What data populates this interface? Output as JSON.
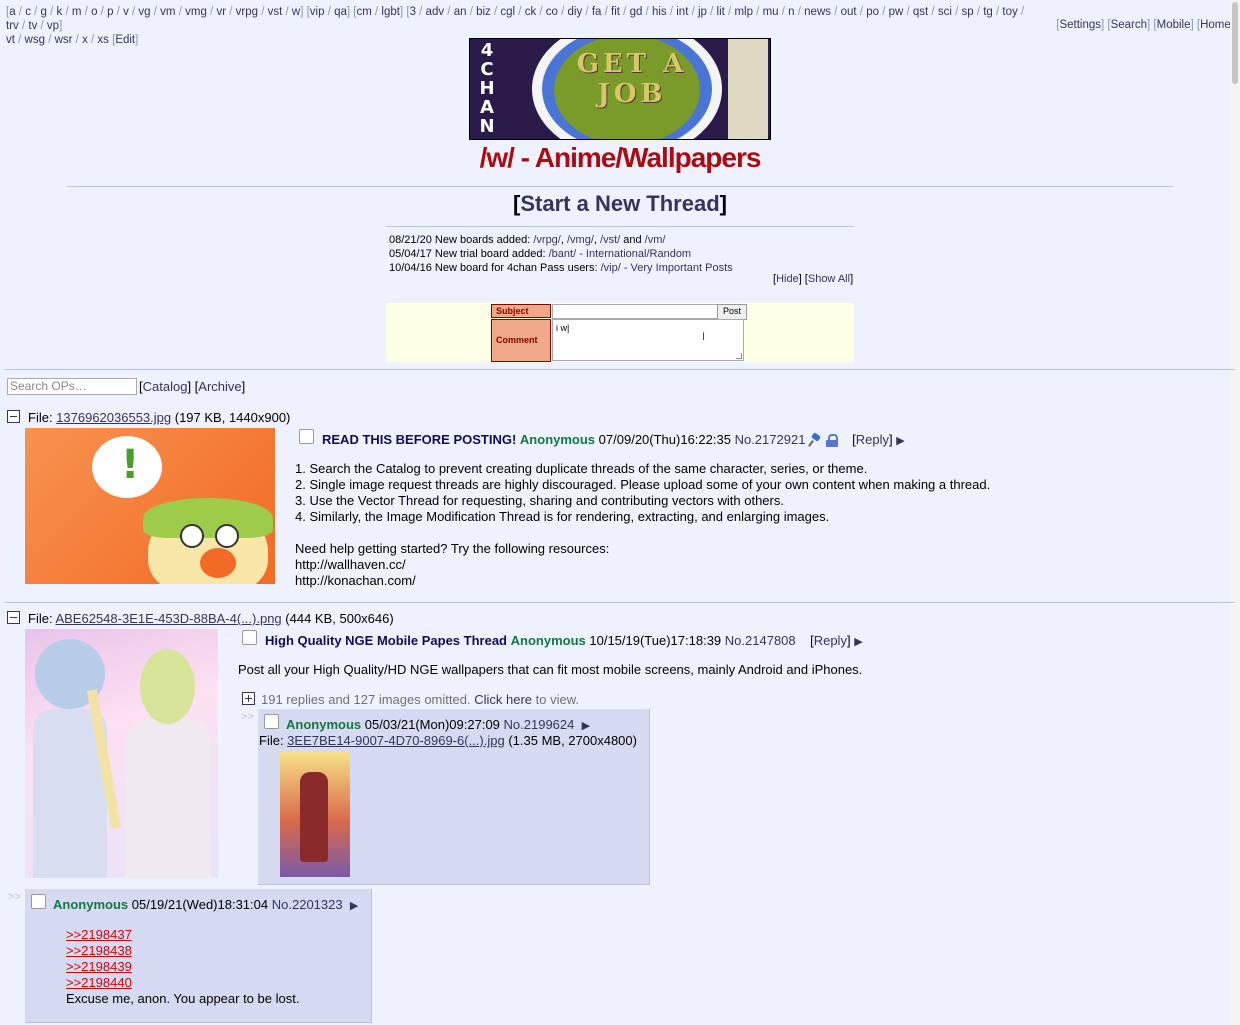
{
  "nav": {
    "boards_line1": [
      "a",
      "c",
      "g",
      "k",
      "m",
      "o",
      "p",
      "v",
      "vg",
      "vm",
      "vmg",
      "vr",
      "vrpg",
      "vst",
      "w",
      "vip",
      "qa",
      "cm",
      "lgbt",
      "3",
      "adv",
      "an",
      "biz",
      "cgl",
      "ck",
      "co",
      "diy",
      "fa",
      "fit",
      "gd",
      "his",
      "int",
      "jp",
      "lit",
      "mlp",
      "mu",
      "n",
      "news",
      "out",
      "po",
      "pw",
      "qst",
      "sci",
      "sp",
      "tg",
      "toy",
      "trv",
      "tv",
      "vp"
    ],
    "boards_line2": [
      "vt",
      "wsg",
      "wsr",
      "x",
      "xs"
    ],
    "edit": "Edit",
    "right_links": [
      "Settings",
      "Search",
      "Mobile",
      "Home"
    ]
  },
  "banner": {
    "brand": "4CHAN",
    "text": "GET A JOB"
  },
  "board": {
    "title": "/w/ - Anime/Wallpapers",
    "new_thread": "Start a New Thread"
  },
  "news": [
    {
      "date": "08/21/20",
      "text": "New boards added: ",
      "links": [
        "/vrpg/",
        "/vmg/",
        "/vst/"
      ],
      "tail_and": "and",
      "last": "/vm/"
    },
    {
      "date": "05/04/17",
      "text": "New trial board added: ",
      "link": "/bant/ - International/Random"
    },
    {
      "date": "10/04/16",
      "text": "New board for 4chan Pass users: ",
      "link": "/vip/ - Very Important Posts"
    }
  ],
  "news_controls": {
    "hide": "Hide",
    "show_all": "Show All"
  },
  "form": {
    "subject_label": "Subject",
    "comment_label": "Comment",
    "post_button": "Post",
    "comment_value": "i w|"
  },
  "ops_search": {
    "placeholder": "Search OPs…"
  },
  "ops_links": {
    "catalog": "Catalog",
    "archive": "Archive"
  },
  "threads": [
    {
      "file_label": "File: ",
      "file_name": "1376962036553.jpg",
      "file_meta": "(197 KB, 1440x900)",
      "subject": "READ THIS BEFORE POSTING!",
      "name": "Anonymous",
      "datetime": "07/09/20(Thu)16:22:35",
      "no": "No.2172921",
      "reply": "Reply",
      "lines": [
        "1. Search the Catalog to prevent creating duplicate threads of the same character, series, or theme.",
        "2. Single image request threads are highly discouraged. Please upload some of your own content when making a thread.",
        "3. Use the Vector Thread for requesting, sharing and contributing vectors with others.",
        "4. Similarly, the Image Modification Thread is for rendering, extracting, and enlarging images.",
        "",
        "Need help getting started? Try the following resources:",
        "http://wallhaven.cc/",
        "http://konachan.com/"
      ]
    },
    {
      "file_label": "File: ",
      "file_name": "ABE62548-3E1E-453D-88BA-4(...).png",
      "file_meta": "(444 KB, 500x646)",
      "subject": "High Quality NGE Mobile Papes Thread",
      "name": "Anonymous",
      "datetime": "10/15/19(Tue)17:18:39",
      "no": "No.2147808",
      "reply": "Reply",
      "message": "Post all your High Quality/HD NGE wallpapers that can fit most mobile screens, mainly Android and iPhones.",
      "omitted": "191 replies and 127 images omitted.",
      "click_here": "Click here",
      "to_view": "to view.",
      "replies": [
        {
          "name": "Anonymous",
          "datetime": "05/03/21(Mon)09:27:09",
          "no": "No.2199624",
          "file_label": "File: ",
          "file_name": "3EE7BE14-9007-4D70-8969-6(...).jpg",
          "file_meta": "(1.35 MB, 2700x4800)"
        },
        {
          "name": "Anonymous",
          "datetime": "05/19/21(Wed)18:31:04",
          "no": "No.2201323",
          "quotes": [
            ">>2198437",
            ">>2198438",
            ">>2198439",
            ">>2198440"
          ],
          "text": "Excuse me, anon. You appear to be lost."
        }
      ]
    }
  ],
  "colors": {
    "bg": "#eef2ff",
    "title_red": "#af0a0f",
    "name_green": "#117743",
    "subject_blue": "#0f0c5d",
    "reply_bg": "#d6daf0",
    "quote_red": "#dd0000"
  }
}
